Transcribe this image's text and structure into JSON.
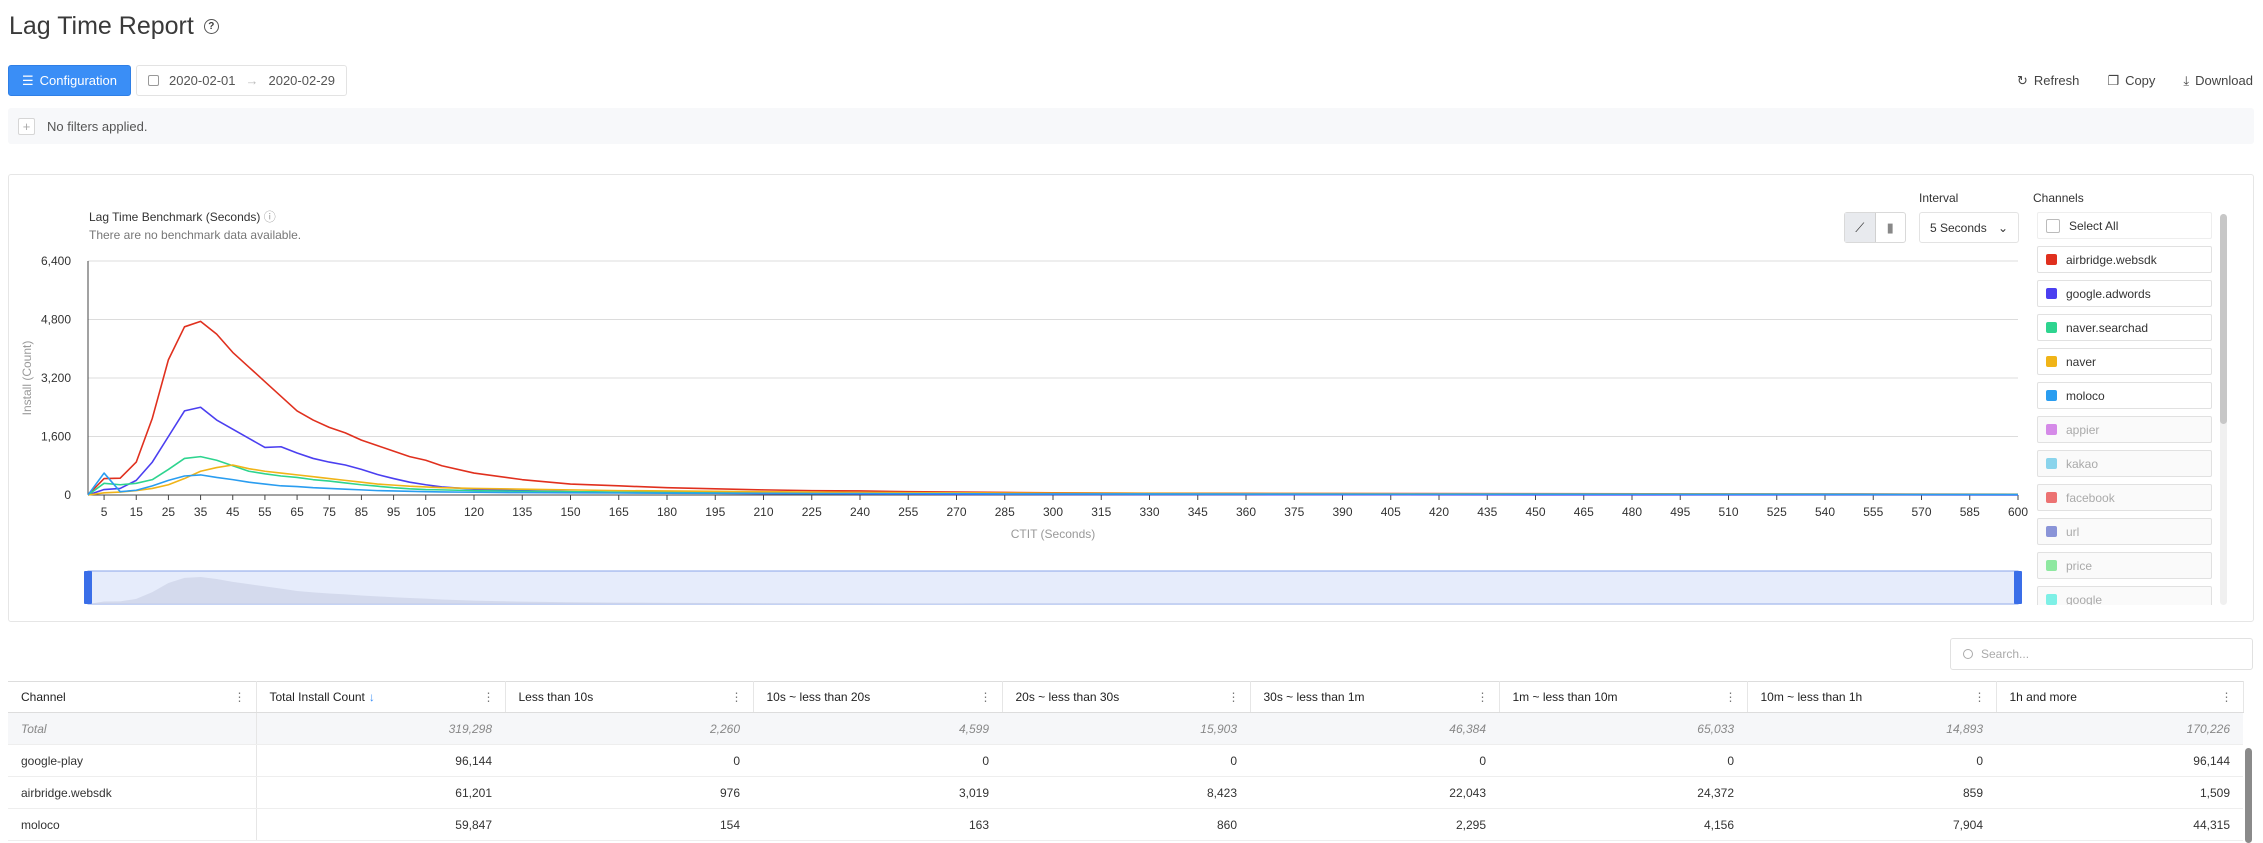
{
  "page": {
    "title": "Lag Time Report",
    "help_icon": "question-circle-icon"
  },
  "toolbar": {
    "config_label": "Configuration",
    "date_start": "2020-02-01",
    "date_end": "2020-02-29",
    "refresh_label": "Refresh",
    "copy_label": "Copy",
    "download_label": "Download"
  },
  "filters": {
    "text": "No filters applied."
  },
  "chart_panel": {
    "interval_label": "Interval",
    "interval_value": "5 Seconds",
    "channels_label": "Channels",
    "select_all": "Select All",
    "channels": [
      {
        "name": "airbridge.websdk",
        "color": "#e0301e",
        "active": true
      },
      {
        "name": "google.adwords",
        "color": "#4b3ff0",
        "active": true
      },
      {
        "name": "naver.searchad",
        "color": "#2ed48f",
        "active": true
      },
      {
        "name": "naver",
        "color": "#f0b418",
        "active": true
      },
      {
        "name": "moloco",
        "color": "#2a9df0",
        "active": true
      },
      {
        "name": "appier",
        "color": "#d58ae8",
        "active": false
      },
      {
        "name": "kakao",
        "color": "#8ad4ec",
        "active": false
      },
      {
        "name": "facebook",
        "color": "#ec7272",
        "active": false
      },
      {
        "name": "url",
        "color": "#8a94d8",
        "active": false
      },
      {
        "name": "price",
        "color": "#8ee8a0",
        "active": false
      },
      {
        "name": "google",
        "color": "#7ef0e6",
        "active": false
      }
    ]
  },
  "chart_data": {
    "type": "line",
    "title": "Lag Time Benchmark (Seconds)",
    "subtitle": "There are no benchmark data available.",
    "xlabel": "CTIT (Seconds)",
    "ylabel": "Install (Count)",
    "ylim": [
      0,
      6400
    ],
    "yticks": [
      "0",
      "1,600",
      "3,200",
      "4,800",
      "6,400"
    ],
    "xlim": [
      0,
      600
    ],
    "xticks": [
      5,
      15,
      25,
      35,
      45,
      55,
      65,
      75,
      85,
      95,
      105,
      120,
      135,
      150,
      165,
      180,
      195,
      210,
      225,
      240,
      255,
      270,
      285,
      300,
      315,
      330,
      345,
      360,
      375,
      390,
      405,
      420,
      435,
      450,
      465,
      480,
      495,
      510,
      525,
      540,
      555,
      570,
      585,
      600
    ],
    "x": [
      0,
      5,
      10,
      15,
      20,
      25,
      30,
      35,
      40,
      45,
      50,
      55,
      60,
      65,
      70,
      75,
      80,
      85,
      90,
      95,
      100,
      105,
      110,
      120,
      135,
      150,
      165,
      180,
      195,
      210,
      225,
      240,
      255,
      270,
      285,
      300,
      330,
      360,
      400,
      450,
      500,
      550,
      600
    ],
    "series": [
      {
        "name": "airbridge.websdk",
        "color": "#e0301e",
        "values": [
          0,
          450,
          460,
          900,
          2100,
          3700,
          4600,
          4750,
          4400,
          3900,
          3500,
          3100,
          2700,
          2300,
          2050,
          1850,
          1700,
          1500,
          1350,
          1200,
          1050,
          950,
          800,
          600,
          420,
          300,
          250,
          200,
          170,
          140,
          120,
          110,
          90,
          80,
          70,
          60,
          50,
          45,
          40,
          35,
          30,
          25,
          20
        ]
      },
      {
        "name": "google.adwords",
        "color": "#4b3ff0",
        "values": [
          0,
          150,
          180,
          400,
          900,
          1600,
          2300,
          2400,
          2050,
          1800,
          1550,
          1300,
          1320,
          1150,
          1000,
          900,
          820,
          700,
          560,
          450,
          350,
          280,
          220,
          160,
          120,
          90,
          70,
          60,
          50,
          40,
          35,
          30,
          25,
          20,
          18,
          15,
          12,
          10,
          8,
          6,
          5,
          4,
          3
        ]
      },
      {
        "name": "naver.searchad",
        "color": "#2ed48f",
        "values": [
          0,
          320,
          280,
          320,
          420,
          700,
          1000,
          1050,
          950,
          800,
          650,
          580,
          520,
          480,
          420,
          380,
          330,
          280,
          240,
          200,
          170,
          150,
          140,
          120,
          100,
          90,
          80,
          75,
          70,
          60,
          55,
          50,
          45,
          40,
          40,
          35,
          30,
          30,
          28,
          25,
          22,
          20,
          18
        ]
      },
      {
        "name": "naver",
        "color": "#f0b418",
        "values": [
          0,
          60,
          80,
          120,
          180,
          280,
          450,
          650,
          750,
          820,
          720,
          650,
          600,
          550,
          500,
          450,
          400,
          350,
          300,
          270,
          240,
          220,
          200,
          180,
          160,
          140,
          120,
          110,
          100,
          90,
          80,
          70,
          65,
          60,
          55,
          50,
          45,
          40,
          35,
          30,
          28,
          25,
          22
        ]
      },
      {
        "name": "moloco",
        "color": "#2a9df0",
        "values": [
          0,
          600,
          90,
          130,
          250,
          400,
          520,
          550,
          480,
          420,
          350,
          300,
          250,
          230,
          200,
          180,
          160,
          140,
          120,
          110,
          100,
          90,
          85,
          75,
          65,
          60,
          55,
          50,
          45,
          45,
          40,
          40,
          35,
          35,
          30,
          30,
          28,
          26,
          24,
          22,
          20,
          18,
          16
        ]
      }
    ]
  },
  "table": {
    "search_placeholder": "Search...",
    "columns": [
      "Channel",
      "Total Install Count",
      "Less than 10s",
      "10s ~ less than 20s",
      "20s ~ less than 30s",
      "30s ~ less than 1m",
      "1m ~ less than 10m",
      "10m ~ less than 1h",
      "1h and more"
    ],
    "total_row": [
      "Total",
      "319,298",
      "2,260",
      "4,599",
      "15,903",
      "46,384",
      "65,033",
      "14,893",
      "170,226"
    ],
    "rows": [
      [
        "google-play",
        "96,144",
        "0",
        "0",
        "0",
        "0",
        "0",
        "0",
        "96,144"
      ],
      [
        "airbridge.websdk",
        "61,201",
        "976",
        "3,019",
        "8,423",
        "22,043",
        "24,372",
        "859",
        "1,509"
      ],
      [
        "moloco",
        "59,847",
        "154",
        "163",
        "860",
        "2,295",
        "4,156",
        "7,904",
        "44,315"
      ]
    ]
  }
}
